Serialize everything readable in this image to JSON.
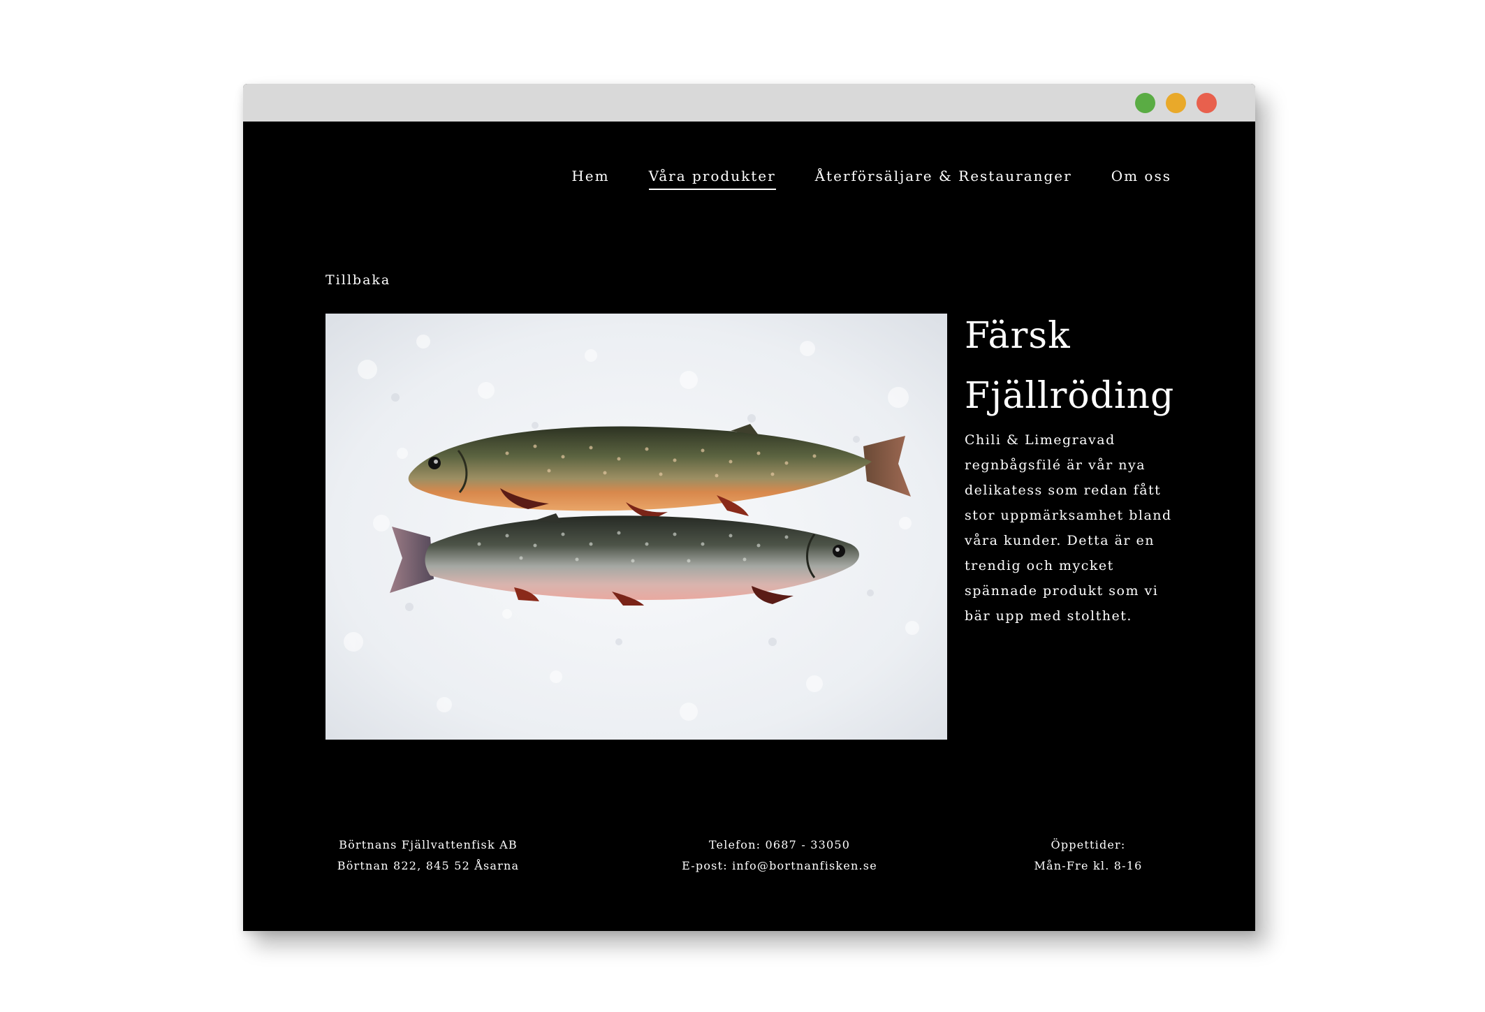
{
  "window": {
    "controls": {
      "green": "#5aac44",
      "yellow": "#e9a92a",
      "red": "#e8604d"
    }
  },
  "nav": {
    "items": [
      {
        "label": "Hem"
      },
      {
        "label": "Våra produkter",
        "active": true
      },
      {
        "label": "Återförsäljare & Restauranger"
      },
      {
        "label": "Om oss"
      }
    ]
  },
  "back_link": "Tillbaka",
  "product": {
    "title": "Färsk Fjällröding",
    "description": "Chili & Limegravad regnbågsfilé är vår nya delikatess som redan fått stor uppmärksamhet bland våra kunder. Detta är en trendig och mycket spännade produkt som vi bär upp med stolthet.",
    "image": "two-arctic-char-on-ice"
  },
  "footer": {
    "company_name": "Börtnans Fjällvattenfisk AB",
    "address": "Börtnan 822, 845 52 Åsarna",
    "phone": "Telefon: 0687 - 33050",
    "email": "E-post: info@bortnanfisken.se",
    "hours_label": "Öppettider:",
    "hours": "Mån-Fre kl. 8-16"
  }
}
